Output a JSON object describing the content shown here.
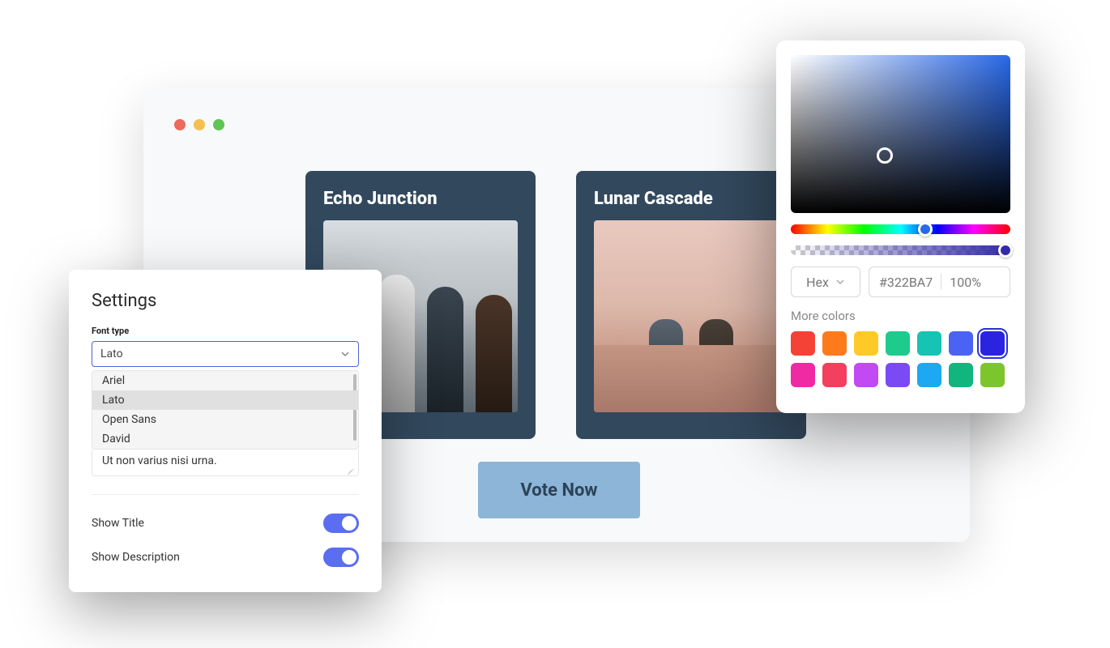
{
  "browser": {
    "cards": [
      {
        "title": "Echo Junction"
      },
      {
        "title": "Lunar Cascade"
      }
    ],
    "vote_label": "Vote Now"
  },
  "settings": {
    "title": "Settings",
    "font_type_label": "Font type",
    "font_selected": "Lato",
    "font_options": [
      "Ariel",
      "Lato",
      "Open Sans",
      "David"
    ],
    "sample_text": "Ut non varius nisi urna.",
    "show_title_label": "Show Title",
    "show_title": true,
    "show_description_label": "Show Description",
    "show_description": true
  },
  "picker": {
    "mode": "Hex",
    "hex": "#322BA7",
    "alpha": "100%",
    "more_label": "More colors",
    "swatches": [
      "#F44336",
      "#FF7A1A",
      "#FFCA28",
      "#1ECB8C",
      "#17C3B2",
      "#4A63F5",
      "#2A24E0",
      "#F02AA3",
      "#F43F5E",
      "#C14AF5",
      "#7A4AF5",
      "#1CA8F2",
      "#11B57E",
      "#7CC62B"
    ],
    "selected_swatch_index": 6
  }
}
